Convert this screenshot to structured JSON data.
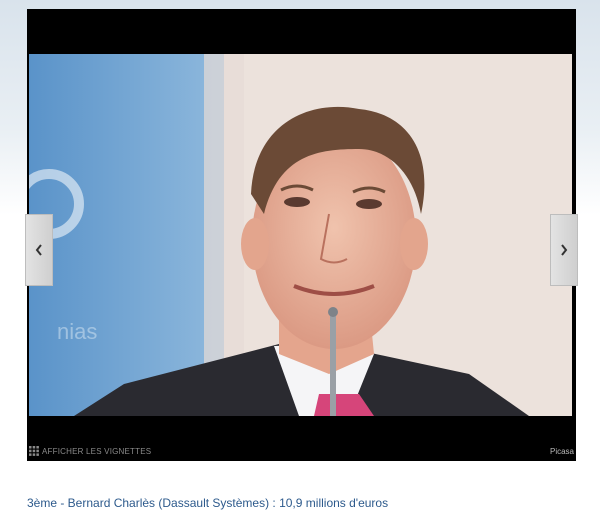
{
  "gallery": {
    "thumbnails_label": "AFFICHER LES VIGNETTES",
    "provider": "Picasa",
    "icons": {
      "prev": "chevron-left-icon",
      "next": "chevron-right-icon",
      "thumbnails": "grid-icon"
    }
  },
  "caption": "3ème - Bernard Charlès (Dassault Systèmes) : 10,9 millions d'euros"
}
